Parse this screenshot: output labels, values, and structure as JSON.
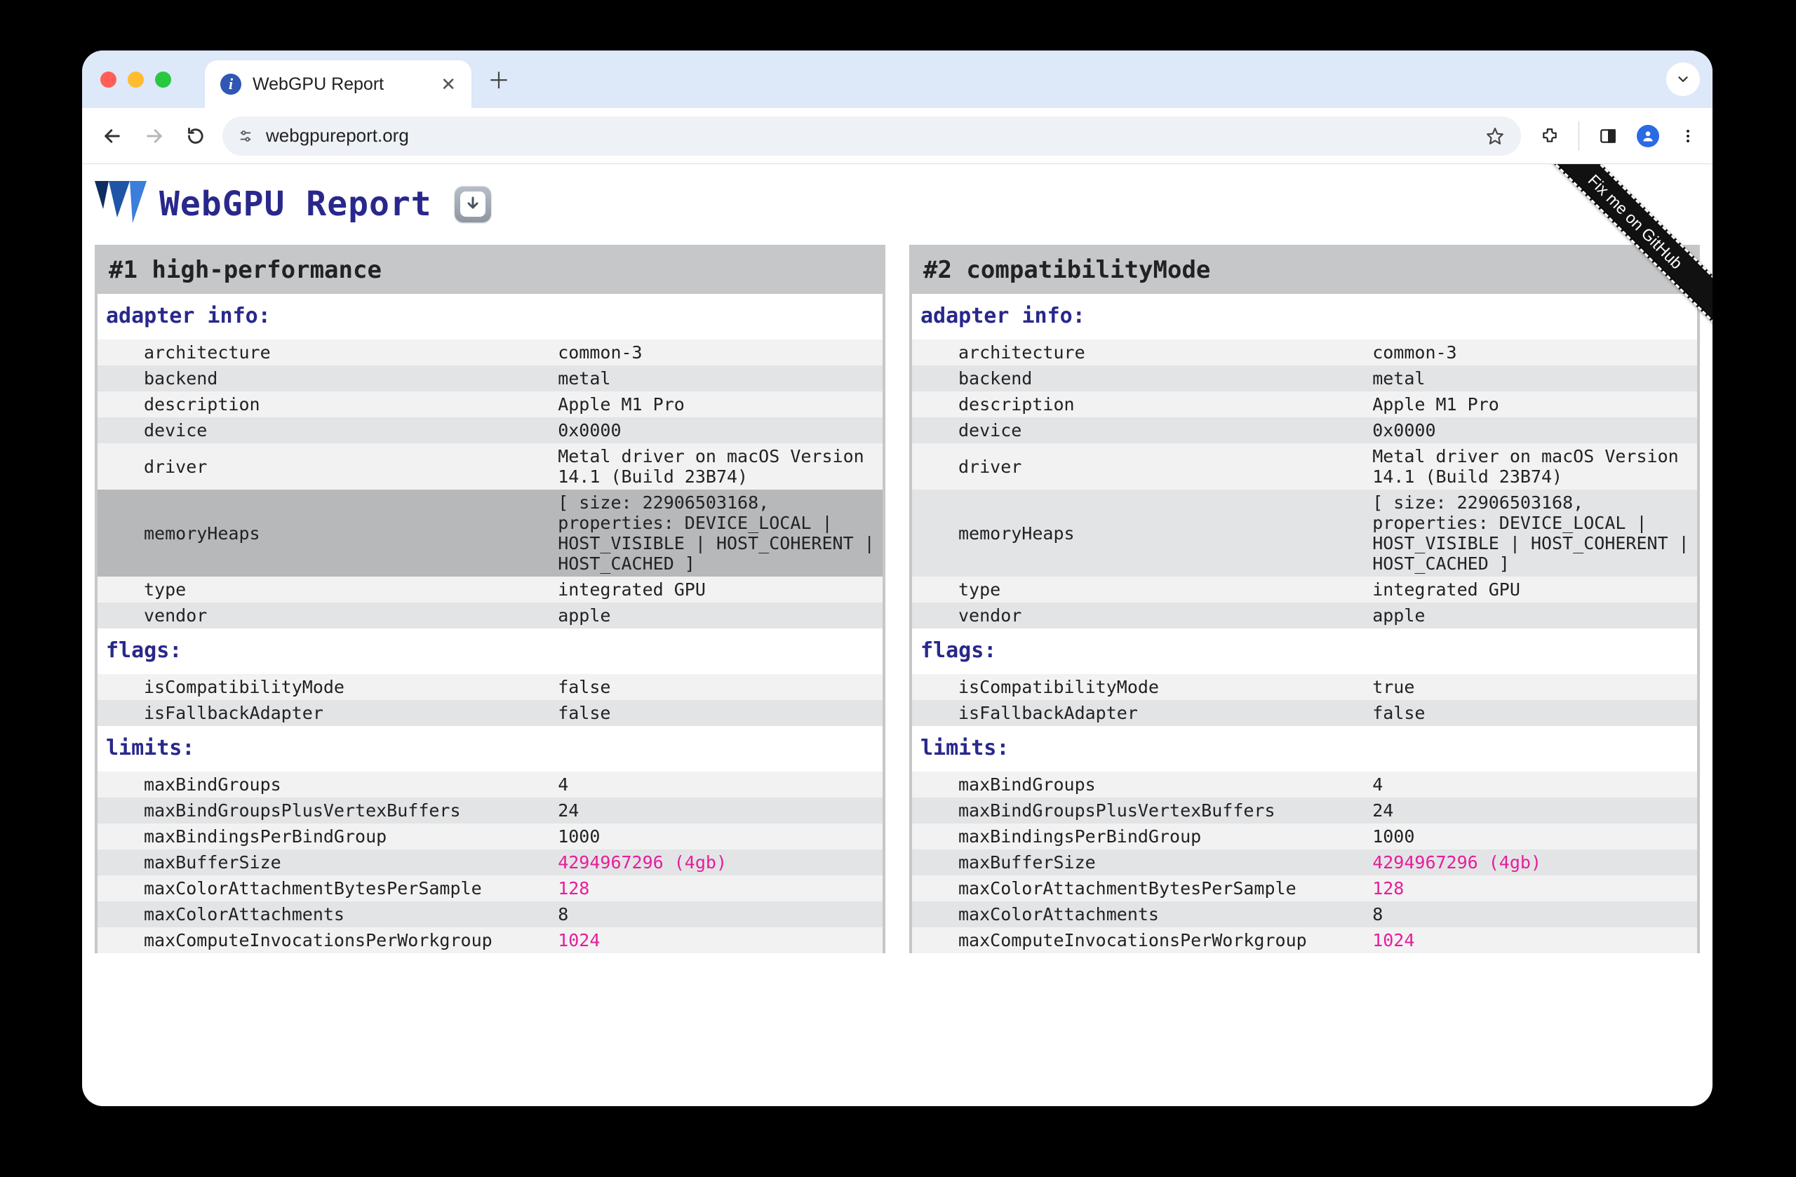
{
  "browser": {
    "tab": {
      "title": "WebGPU Report"
    },
    "url": "webgpureport.org"
  },
  "page": {
    "title": "WebGPU  Report",
    "ribbon": "Fix me on GitHub",
    "icons": {
      "download": "download-icon"
    }
  },
  "columns": [
    {
      "title": "#1 high-performance",
      "highlightKey": "memoryHeaps",
      "sections": [
        {
          "name": "adapter info:",
          "rows": [
            {
              "k": "architecture",
              "v": "common-3"
            },
            {
              "k": "backend",
              "v": "metal"
            },
            {
              "k": "description",
              "v": "Apple M1 Pro"
            },
            {
              "k": "device",
              "v": "0x0000"
            },
            {
              "k": "driver",
              "v": "Metal driver on macOS Version 14.1 (Build 23B74)"
            },
            {
              "k": "memoryHeaps",
              "v": "[ size: 22906503168, properties: DEVICE_LOCAL | HOST_VISIBLE | HOST_COHERENT | HOST_CACHED ]"
            },
            {
              "k": "type",
              "v": "integrated GPU"
            },
            {
              "k": "vendor",
              "v": "apple"
            }
          ]
        },
        {
          "name": "flags:",
          "rows": [
            {
              "k": "isCompatibilityMode",
              "v": "false"
            },
            {
              "k": "isFallbackAdapter",
              "v": "false"
            }
          ]
        },
        {
          "name": "limits:",
          "rows": [
            {
              "k": "maxBindGroups",
              "v": "4"
            },
            {
              "k": "maxBindGroupsPlusVertexBuffers",
              "v": "24"
            },
            {
              "k": "maxBindingsPerBindGroup",
              "v": "1000"
            },
            {
              "k": "maxBufferSize",
              "v": "4294967296 (4gb)",
              "pink": true
            },
            {
              "k": "maxColorAttachmentBytesPerSample",
              "v": "128",
              "pink": true
            },
            {
              "k": "maxColorAttachments",
              "v": "8"
            },
            {
              "k": "maxComputeInvocationsPerWorkgroup",
              "v": "1024",
              "pink": true
            }
          ]
        }
      ]
    },
    {
      "title": "#2 compatibilityMode",
      "highlightKey": null,
      "sections": [
        {
          "name": "adapter info:",
          "rows": [
            {
              "k": "architecture",
              "v": "common-3"
            },
            {
              "k": "backend",
              "v": "metal"
            },
            {
              "k": "description",
              "v": "Apple M1 Pro"
            },
            {
              "k": "device",
              "v": "0x0000"
            },
            {
              "k": "driver",
              "v": "Metal driver on macOS Version 14.1 (Build 23B74)"
            },
            {
              "k": "memoryHeaps",
              "v": "[ size: 22906503168, properties: DEVICE_LOCAL | HOST_VISIBLE | HOST_COHERENT | HOST_CACHED ]"
            },
            {
              "k": "type",
              "v": "integrated GPU"
            },
            {
              "k": "vendor",
              "v": "apple"
            }
          ]
        },
        {
          "name": "flags:",
          "rows": [
            {
              "k": "isCompatibilityMode",
              "v": "true"
            },
            {
              "k": "isFallbackAdapter",
              "v": "false"
            }
          ]
        },
        {
          "name": "limits:",
          "rows": [
            {
              "k": "maxBindGroups",
              "v": "4"
            },
            {
              "k": "maxBindGroupsPlusVertexBuffers",
              "v": "24"
            },
            {
              "k": "maxBindingsPerBindGroup",
              "v": "1000"
            },
            {
              "k": "maxBufferSize",
              "v": "4294967296 (4gb)",
              "pink": true
            },
            {
              "k": "maxColorAttachmentBytesPerSample",
              "v": "128",
              "pink": true
            },
            {
              "k": "maxColorAttachments",
              "v": "8"
            },
            {
              "k": "maxComputeInvocationsPerWorkgroup",
              "v": "1024",
              "pink": true
            }
          ]
        }
      ]
    }
  ]
}
